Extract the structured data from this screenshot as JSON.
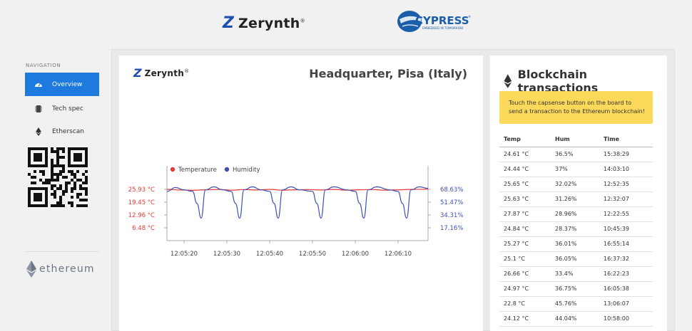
{
  "header": {
    "zerynth_logo": {
      "mark": "Z",
      "text": "Zerynth",
      "reg": "®"
    },
    "cypress_logo": {
      "text": "CYPRESS",
      "tagline": "EMBEDDED IN TOMORROW",
      "reg": "®"
    }
  },
  "sidebar": {
    "title": "NAVIGATION",
    "items": [
      {
        "label": "Overview",
        "icon": "gauge-icon",
        "active": true
      },
      {
        "label": "Tech spec",
        "icon": "chip-icon",
        "active": false
      },
      {
        "label": "Etherscan",
        "icon": "ethereum-icon",
        "active": false
      }
    ],
    "ethereum_logo": "ethereum"
  },
  "chart_panel": {
    "logo": {
      "mark": "Z",
      "text": "Zerynth",
      "reg": "®"
    },
    "title": "Headquarter, Pisa (Italy)"
  },
  "chart_data": {
    "type": "line",
    "legend": [
      "Temperature",
      "Humidity"
    ],
    "legend_position": "top-left",
    "x_ticks": [
      "12:05:20",
      "12:05:30",
      "12:05:40",
      "12:05:50",
      "12:06:00",
      "12:06:10"
    ],
    "y_left_ticks": [
      "25.93 °C",
      "19.45 °C",
      "12.96 °C",
      "6.48 °C"
    ],
    "y_right_ticks": [
      "68.63%",
      "51.47%",
      "34.31%",
      "17.16%"
    ],
    "x_range": [
      "12:05:16",
      "12:06:17"
    ],
    "y_left_range": [
      0,
      32.4
    ],
    "y_right_range": [
      0,
      85.8
    ],
    "grid": false,
    "colors": {
      "temperature": "#e53935",
      "humidity": "#3f51b5"
    },
    "series": [
      {
        "name": "Temperature",
        "axis": "left",
        "unit": "°C",
        "x": [
          "12:05:16",
          "12:05:19",
          "12:05:22",
          "12:05:25",
          "12:05:28",
          "12:05:31",
          "12:05:34",
          "12:05:37",
          "12:05:40",
          "12:05:43",
          "12:05:46",
          "12:05:49",
          "12:05:52",
          "12:05:55",
          "12:05:58",
          "12:06:01",
          "12:06:04",
          "12:06:07",
          "12:06:10",
          "12:06:13",
          "12:06:17"
        ],
        "values": [
          25.93,
          25.6,
          25.4,
          25.7,
          25.9,
          25.5,
          25.8,
          25.6,
          25.9,
          25.5,
          25.7,
          25.8,
          25.6,
          25.9,
          25.5,
          25.7,
          25.8,
          25.5,
          25.7,
          25.9,
          26.0
        ]
      },
      {
        "name": "Humidity",
        "axis": "right",
        "unit": "%",
        "x": [
          "12:05:16",
          "12:05:18",
          "12:05:20",
          "12:05:22",
          "12:05:23",
          "12:05:24",
          "12:05:25",
          "12:05:27",
          "12:05:29",
          "12:05:31",
          "12:05:32",
          "12:05:33",
          "12:05:34",
          "12:05:36",
          "12:05:38",
          "12:05:40",
          "12:05:41",
          "12:05:42",
          "12:05:43",
          "12:05:45",
          "12:05:47",
          "12:05:50",
          "12:05:51",
          "12:05:52",
          "12:05:53",
          "12:05:55",
          "12:05:58",
          "12:06:00",
          "12:06:01",
          "12:06:02",
          "12:06:03",
          "12:06:05",
          "12:06:08",
          "12:06:10",
          "12:06:11",
          "12:06:12",
          "12:06:13",
          "12:06:15",
          "12:06:17"
        ],
        "values": [
          66,
          71,
          68,
          66,
          50,
          30,
          68,
          72,
          68,
          66,
          50,
          30,
          68,
          72,
          68,
          66,
          50,
          30,
          68,
          72,
          68,
          66,
          50,
          30,
          68,
          72,
          68,
          66,
          50,
          30,
          68,
          72,
          68,
          66,
          50,
          30,
          68,
          72,
          70
        ]
      }
    ]
  },
  "tx_panel": {
    "title": "Blockchain transactions",
    "notice": "Touch the capsense button on the board to send a transaction to the Ethereum blockchain!",
    "columns": [
      "Temp",
      "Hum",
      "Time"
    ],
    "rows": [
      [
        "24.61 °C",
        "36.5%",
        "15:38:29"
      ],
      [
        "24.44 °C",
        "37%",
        "14:03:10"
      ],
      [
        "25.65 °C",
        "32.02%",
        "12:52:35"
      ],
      [
        "25.63 °C",
        "31.26%",
        "12:32:07"
      ],
      [
        "27.87 °C",
        "28.96%",
        "12:22:55"
      ],
      [
        "24.84 °C",
        "28.37%",
        "10:45:39"
      ],
      [
        "25.27 °C",
        "36.01%",
        "16:55:14"
      ],
      [
        "25.1 °C",
        "36.05%",
        "16:37:32"
      ],
      [
        "26.66 °C",
        "33.4%",
        "16:22:23"
      ],
      [
        "24.97 °C",
        "36.75%",
        "16:05:38"
      ],
      [
        "22.8 °C",
        "45.76%",
        "13:06:07"
      ],
      [
        "24.12 °C",
        "44.04%",
        "10:58:00"
      ]
    ]
  }
}
